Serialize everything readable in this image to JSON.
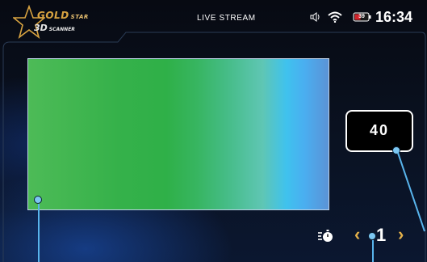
{
  "header": {
    "logo": {
      "line1": "GOLD",
      "line1_small": "STAR",
      "line2": "3D",
      "line2_small": "SCANNER"
    },
    "title": "LIVE STREAM",
    "status": {
      "speaker_icon": "speaker-icon",
      "wifi_icon": "wifi-icon",
      "battery_icon": "battery-icon",
      "battery_level": "39",
      "time": "16:34"
    }
  },
  "scan": {
    "value": "40",
    "gradient_colors": [
      "#4dbb57",
      "#2fb048",
      "#45bc86",
      "#3fc2ee",
      "#5b93d6"
    ]
  },
  "controls": {
    "timer_icon": "timer-icon",
    "prev_label": "‹",
    "step": "1",
    "next_label": "›"
  },
  "colors": {
    "accent_gold": "#e4b14a",
    "pointer_blue": "#58b4ec"
  }
}
